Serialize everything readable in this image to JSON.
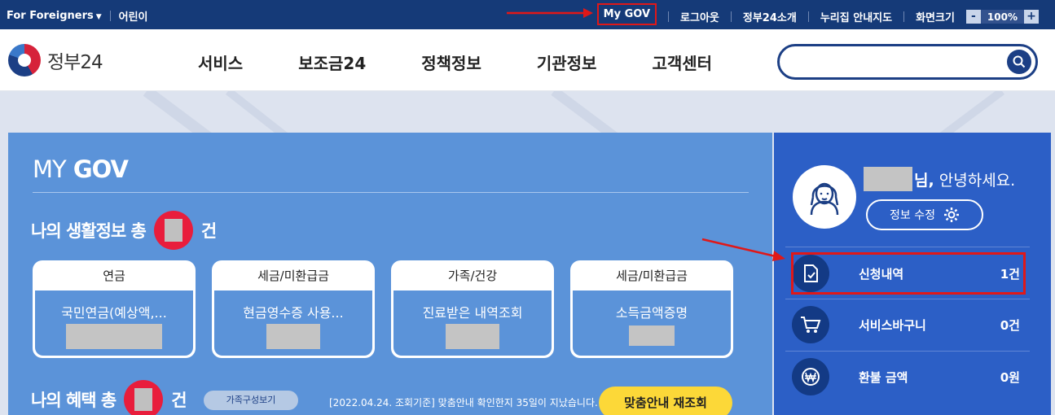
{
  "topbar": {
    "foreigners": "For Foreigners",
    "kids": "어린이",
    "mygov": "My GOV",
    "logout": "로그아웃",
    "about": "정부24소개",
    "sitemap": "누리집 안내지도",
    "screen_size": "화면크기",
    "zoom_minus": "-",
    "zoom_value": "100%",
    "zoom_plus": "+"
  },
  "header": {
    "logo_text": "정부24",
    "nav": [
      "서비스",
      "보조금24",
      "정책정보",
      "기관정보",
      "고객센터"
    ],
    "search_placeholder": ""
  },
  "mygov": {
    "title_thin": "MY",
    "title_bold": "GOV",
    "life_info_prefix": "나의 생활정보 총",
    "life_info_suffix": "건",
    "cards": [
      {
        "category": "연금",
        "title": "국민연금(예상액,..."
      },
      {
        "category": "세금/미환급금",
        "title": "현금영수증 사용..."
      },
      {
        "category": "가족/건강",
        "title": "진료받은 내역조회"
      },
      {
        "category": "세금/미환급금",
        "title": "소득금액증명"
      }
    ],
    "benefit_prefix": "나의 혜택 총",
    "benefit_suffix": "건",
    "family_button": "가족구성보기",
    "notice": "[2022.04.24. 조회기준] 맞춤안내 확인한지 35일이 지났습니다.",
    "reinquire_button": "맞춤안내 재조회"
  },
  "side": {
    "greeting_suffix": "님,",
    "greeting": "안녕하세요.",
    "edit_button": "정보 수정",
    "rows": [
      {
        "label": "신청내역",
        "count": "1건",
        "icon": "document-check-icon"
      },
      {
        "label": "서비스바구니",
        "count": "0건",
        "icon": "cart-icon"
      },
      {
        "label": "환불 금액",
        "count": "0원",
        "icon": "won-icon"
      }
    ]
  },
  "colors": {
    "topbar": "#153a78",
    "panel_blue": "#5b93d9",
    "side_blue": "#2c5fc6",
    "highlight_red": "#e01818",
    "accent_yellow": "#fcd838"
  }
}
